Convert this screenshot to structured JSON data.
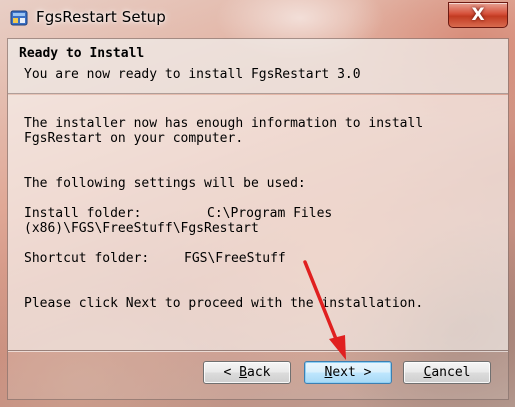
{
  "window": {
    "title": "FgsRestart Setup",
    "close_label": "X"
  },
  "header": {
    "title": "Ready to Install",
    "subtitle": "You are now ready to install FgsRestart 3.0"
  },
  "body": {
    "intro_line1": "The installer now has enough information to install",
    "intro_line2": "FgsRestart on your computer.",
    "settings_heading": "The following settings will be used:",
    "install_folder_label": "Install folder:",
    "install_folder_value_line1": "C:\\Program Files",
    "install_folder_value_line2": "(x86)\\FGS\\FreeStuff\\FgsRestart",
    "shortcut_folder_label": "Shortcut folder:",
    "shortcut_folder_value": "FGS\\FreeStuff",
    "proceed_text": "Please click Next to proceed with the installation."
  },
  "buttons": {
    "back": {
      "prefix": "< ",
      "hotkey": "B",
      "rest": "ack"
    },
    "next": {
      "hotkey": "N",
      "rest": "ext >"
    },
    "cancel": {
      "hotkey": "C",
      "rest": "ancel"
    }
  },
  "colors": {
    "annotation_arrow": "#e02020",
    "close_button": "#c9402a",
    "default_button_border": "#3c7fb1"
  }
}
